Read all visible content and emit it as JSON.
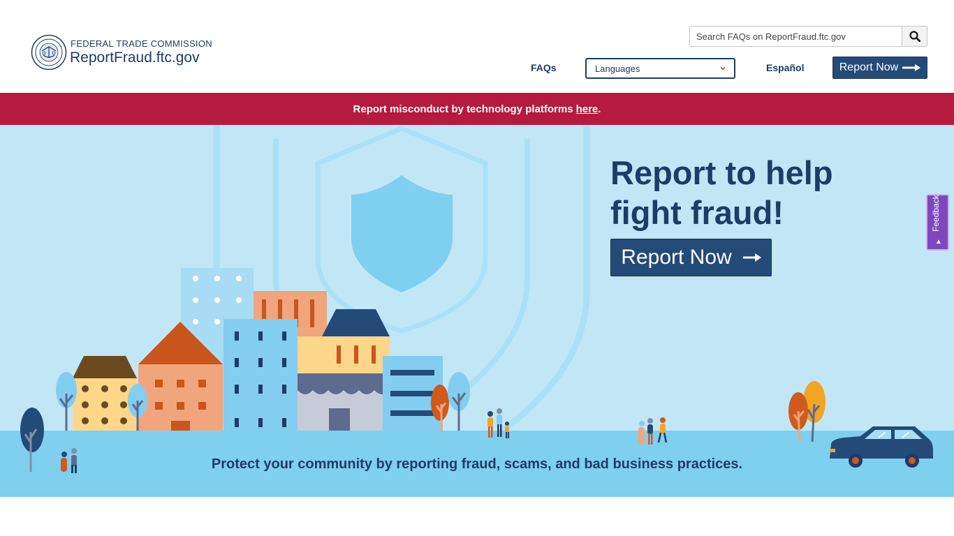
{
  "header": {
    "agency_name": "FEDERAL TRADE COMMISSION",
    "site_name": "ReportFraud.ftc.gov",
    "search": {
      "placeholder": "Search FAQs on ReportFraud.ftc.gov"
    },
    "nav": {
      "faqs_label": "FAQs",
      "languages_label": "Languages",
      "espanol_label": "Español",
      "report_now_label": "Report Now"
    }
  },
  "banner": {
    "text": "Report misconduct by technology platforms",
    "link_text": "here",
    "suffix": ".",
    "background": "#b61a3f"
  },
  "hero": {
    "title_line1": "Report to help",
    "title_line2": "fight fraud!",
    "cta_label": "Report Now",
    "tagline": "Protect your community by reporting fraud, scams, and bad business practices."
  },
  "feedback": {
    "label": "Feedback"
  },
  "icons": {
    "search": "search-icon",
    "arrow": "arrow-right-icon",
    "chevron": "chevron-down-icon",
    "seal": "ftc-seal-logo",
    "shield": "shield-icon"
  },
  "colors": {
    "brand_navy": "#1d3c66",
    "button_navy": "#244a78",
    "hero_sky": "#c1e7f7",
    "ground": "#7fcfee",
    "feedback_purple": "#7f47bd"
  }
}
